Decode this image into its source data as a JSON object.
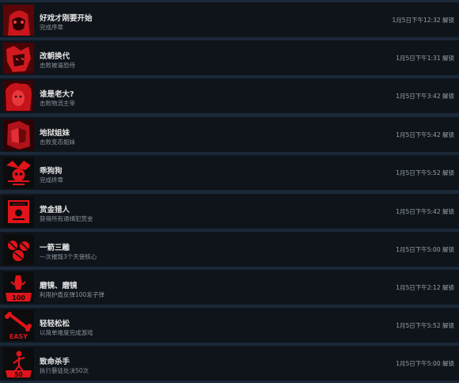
{
  "achievements": [
    {
      "title": "好戏才刚要开始",
      "desc": "完成序章",
      "time": "1月5日下午12:32 解锁",
      "icon": "anime-face-icon"
    },
    {
      "title": "改朝换代",
      "desc": "击败被逼恐侍",
      "time": "1月5日下午1:31 解锁",
      "icon": "warrior-portrait-icon"
    },
    {
      "title": "谁是老大?",
      "desc": "击败物流主宰",
      "time": "1月5日下午3:42 解锁",
      "icon": "red-hair-portrait-icon"
    },
    {
      "title": "地狱姐妹",
      "desc": "击败变态姐妹",
      "time": "1月5日下午5:42 解锁",
      "icon": "sisters-portrait-icon"
    },
    {
      "title": "乖狗狗",
      "desc": "完成终章",
      "time": "1月5日下午5:52 解锁",
      "icon": "jester-skull-icon"
    },
    {
      "title": "赏金猎人",
      "desc": "获得所有通缉犯赏金",
      "time": "1月5日下午5:42 解锁",
      "icon": "wanted-poster-icon"
    },
    {
      "title": "一箭三雕",
      "desc": "一次摧毁3个天使核心",
      "time": "1月5日下午5:00 解锁",
      "icon": "triple-orb-icon"
    },
    {
      "title": "磨镜、磨镜",
      "desc": "利用护盾反弹100发子弹",
      "time": "1月5日下午2:12 解锁",
      "icon": "shield-100-icon"
    },
    {
      "title": "轻轻松松",
      "desc": "以简单难度完成游戏",
      "time": "1月5日下午5:52 解锁",
      "icon": "easy-bone-icon"
    },
    {
      "title": "致命杀手",
      "desc": "执行暴徒处决50次",
      "time": "1月5日下午5:00 解锁",
      "icon": "kill-50-icon"
    }
  ],
  "colors": {
    "accent": "#e0141a",
    "row_bg": "#0f141b",
    "page_bg": "#1b2838"
  }
}
